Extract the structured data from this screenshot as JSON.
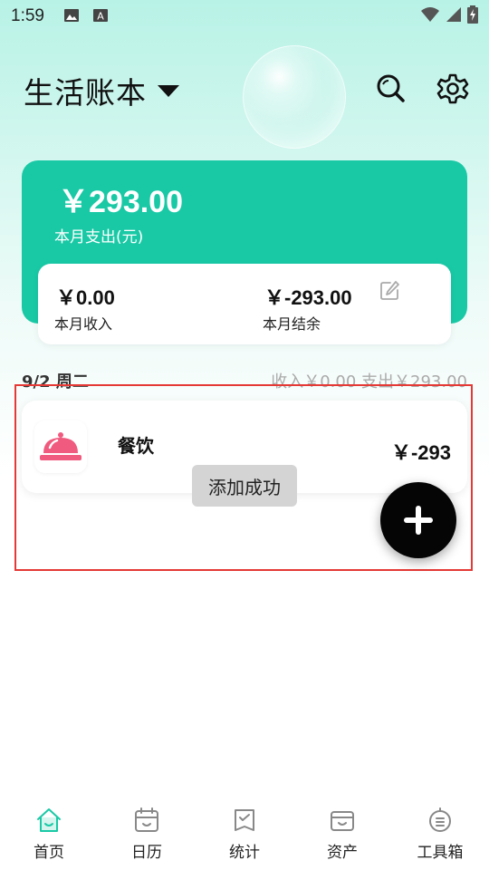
{
  "status_bar": {
    "time": "1:59"
  },
  "header": {
    "title": "生活账本"
  },
  "summary": {
    "month_expense": "￥293.00",
    "month_expense_label": "本月支出(元)",
    "month_income": "￥0.00",
    "month_income_label": "本月收入",
    "month_balance": "￥-293.00",
    "month_balance_label": "本月结余"
  },
  "day": {
    "date": "9/2 周二",
    "summary": "收入￥0.00 支出￥293.00"
  },
  "record": {
    "category": "餐饮",
    "amount": "￥-293",
    "icon": "food-cloche-icon",
    "icon_color": "#f05a7e"
  },
  "toast": {
    "text": "添加成功"
  },
  "nav": {
    "items": [
      {
        "label": "首页",
        "icon": "home-icon",
        "active": true
      },
      {
        "label": "日历",
        "icon": "calendar-icon",
        "active": false
      },
      {
        "label": "统计",
        "icon": "statistics-icon",
        "active": false
      },
      {
        "label": "资产",
        "icon": "wallet-icon",
        "active": false
      },
      {
        "label": "工具箱",
        "icon": "toolbox-icon",
        "active": false
      }
    ]
  },
  "colors": {
    "accent": "#19c9a6",
    "highlight": "#e53935",
    "nav_active": "#19c9a6"
  }
}
